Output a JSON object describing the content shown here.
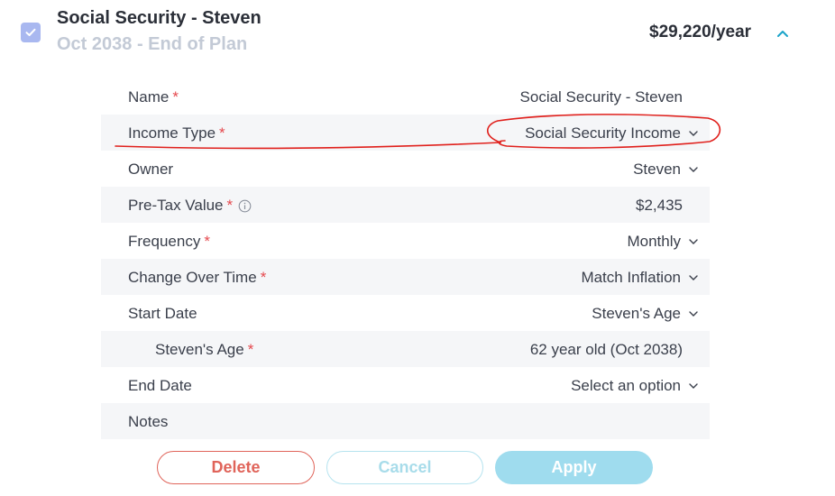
{
  "header": {
    "checked": true,
    "title": "Social Security - Steven",
    "subtitle": "Oct 2038 - End of Plan",
    "amount": "$29,220/year"
  },
  "fields": {
    "name": {
      "label": "Name",
      "required": "*",
      "value": "Social Security - Steven"
    },
    "income_type": {
      "label": "Income Type",
      "required": "*",
      "value": "Social Security Income"
    },
    "owner": {
      "label": "Owner",
      "value": "Steven"
    },
    "pre_tax_value": {
      "label": "Pre-Tax Value",
      "required": "*",
      "value": "$2,435"
    },
    "frequency": {
      "label": "Frequency",
      "required": "*",
      "value": "Monthly"
    },
    "change_over_time": {
      "label": "Change Over Time",
      "required": "*",
      "value": "Match Inflation"
    },
    "start_date": {
      "label": "Start Date",
      "value": "Steven's Age"
    },
    "stevens_age": {
      "label": "Steven's Age",
      "required": "*",
      "value": "62 year old (Oct 2038)"
    },
    "end_date": {
      "label": "End Date",
      "value": "Select an option"
    },
    "notes": {
      "label": "Notes",
      "value": ""
    }
  },
  "buttons": {
    "delete": "Delete",
    "cancel": "Cancel",
    "apply": "Apply"
  },
  "colors": {
    "accent": "#1aa3c9",
    "required": "#e5484d",
    "annotation": "#e0201c",
    "row_shade": "#f5f6f8"
  }
}
